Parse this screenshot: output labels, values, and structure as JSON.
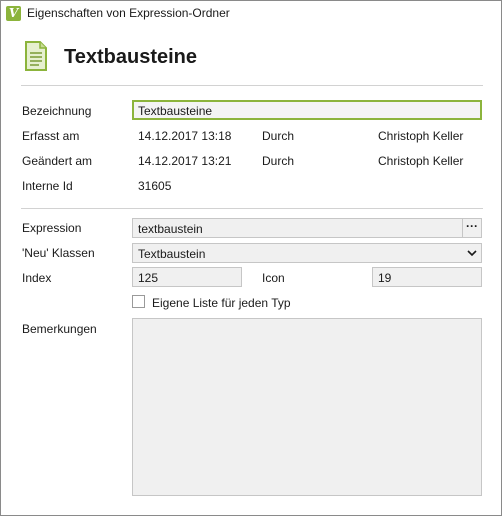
{
  "window": {
    "title": "Eigenschaften von Expression-Ordner",
    "app_icon_letter": "V"
  },
  "header": {
    "title": "Textbausteine",
    "icon": "document-icon"
  },
  "general": {
    "bezeichnung_label": "Bezeichnung",
    "bezeichnung_value": "Textbausteine",
    "erfasst_label": "Erfasst am",
    "erfasst_datum": "14.12.2017 13:18",
    "erfasst_durch_label": "Durch",
    "erfasst_durch": "Christoph Keller",
    "geaendert_label": "Geändert am",
    "geaendert_datum": "14.12.2017 13:21",
    "geaendert_durch_label": "Durch",
    "geaendert_durch": "Christoph Keller",
    "interne_id_label": "Interne Id",
    "interne_id": "31605"
  },
  "details": {
    "expression_label": "Expression",
    "expression_value": "textbaustein",
    "expression_button": "···",
    "neu_klassen_label": "'Neu' Klassen",
    "neu_klassen_value": "Textbaustein",
    "index_label": "Index",
    "index_value": "125",
    "icon_label": "Icon",
    "icon_value": "19",
    "eigene_liste_label": "Eigene Liste für jeden Typ",
    "eigene_liste_checked": false,
    "bemerkungen_label": "Bemerkungen",
    "bemerkungen_value": ""
  },
  "colors": {
    "accent": "#8cb43c",
    "field_bg": "#f0f0f0",
    "field_border": "#c6c6c6",
    "separator": "#d2d2d2"
  }
}
